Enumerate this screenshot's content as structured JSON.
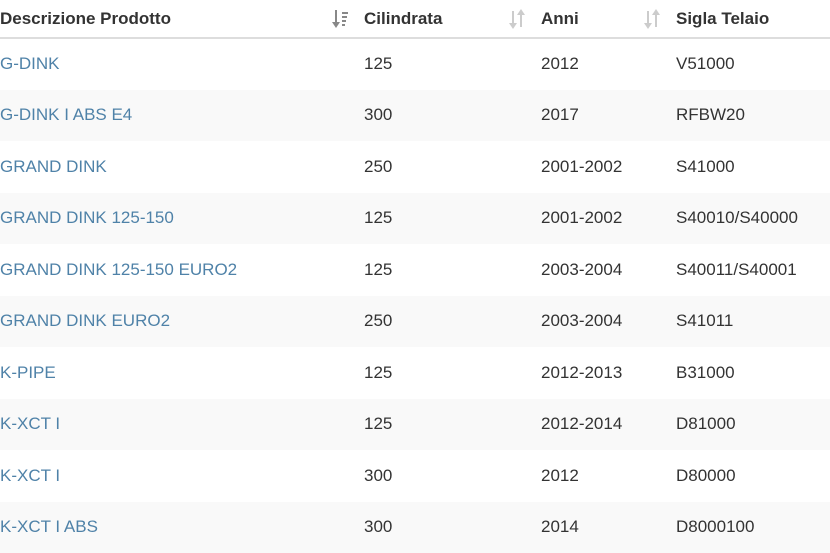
{
  "table": {
    "headers": {
      "description": "Descrizione Prodotto",
      "displacement": "Cilindrata",
      "years": "Anni",
      "frame_code": "Sigla Telaio"
    },
    "sort_icons": {
      "description": "sort-descending-active-icon",
      "displacement": "sort-both-icon",
      "years": "sort-both-icon"
    },
    "colors": {
      "link": "#4f82a8",
      "text": "#333333",
      "row_alt": "#f9f9f9",
      "border": "#dddddd",
      "sort_inactive": "#cccccc",
      "sort_active": "#888888"
    },
    "rows": [
      {
        "description": "G-DINK",
        "displacement": "125",
        "years": "2012",
        "frame_code": "V51000"
      },
      {
        "description": "G-DINK I ABS E4",
        "displacement": "300",
        "years": "2017",
        "frame_code": "RFBW20"
      },
      {
        "description": "GRAND DINK",
        "displacement": "250",
        "years": "2001-2002",
        "frame_code": "S41000"
      },
      {
        "description": "GRAND DINK 125-150",
        "displacement": "125",
        "years": "2001-2002",
        "frame_code": "S40010/S40000"
      },
      {
        "description": "GRAND DINK 125-150 EURO2",
        "displacement": "125",
        "years": "2003-2004",
        "frame_code": "S40011/S40001"
      },
      {
        "description": "GRAND DINK EURO2",
        "displacement": "250",
        "years": "2003-2004",
        "frame_code": "S41011"
      },
      {
        "description": "K-PIPE",
        "displacement": "125",
        "years": "2012-2013",
        "frame_code": "B31000"
      },
      {
        "description": "K-XCT I",
        "displacement": "125",
        "years": "2012-2014",
        "frame_code": "D81000"
      },
      {
        "description": "K-XCT I",
        "displacement": "300",
        "years": "2012",
        "frame_code": "D80000"
      },
      {
        "description": "K-XCT I ABS",
        "displacement": "300",
        "years": "2014",
        "frame_code": "D8000100"
      }
    ]
  }
}
